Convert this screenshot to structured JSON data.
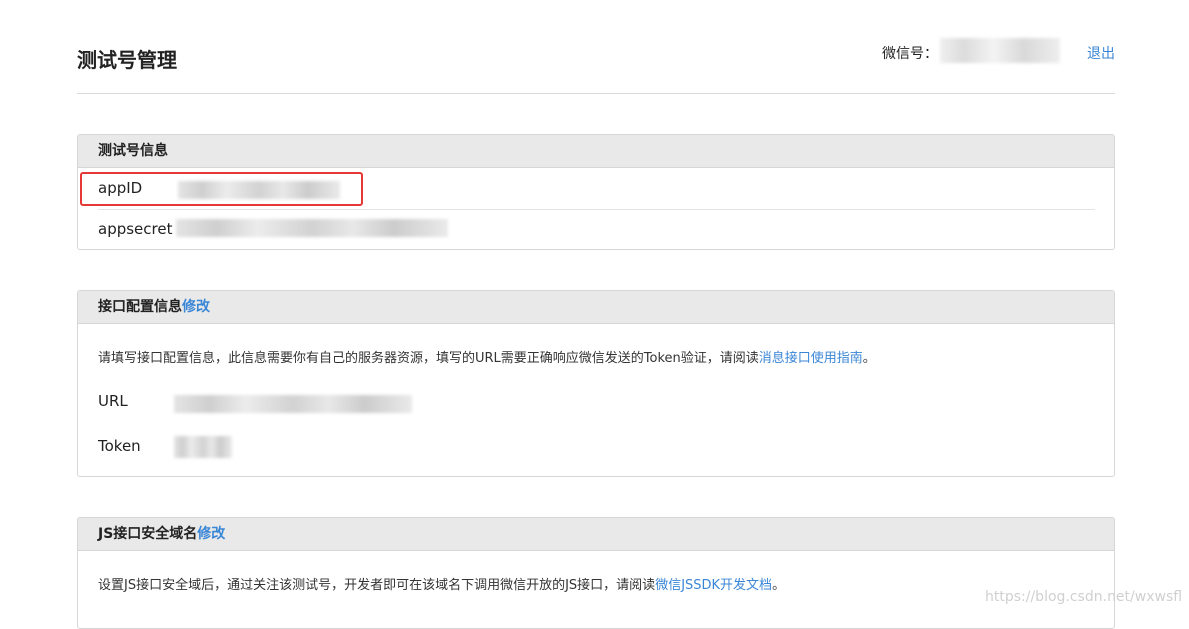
{
  "header": {
    "title": "测试号管理",
    "account_label": "微信号：",
    "logout_label": "退出"
  },
  "test_account_panel": {
    "title": "测试号信息",
    "fields": [
      {
        "label": "appID"
      },
      {
        "label": "appsecret"
      }
    ]
  },
  "interface_panel": {
    "title": "接口配置信息",
    "edit_label": "修改",
    "description": "请填写接口配置信息，此信息需要你有自己的服务器资源，填写的URL需要正确响应微信发送的Token验证，请阅读",
    "guide_link": "消息接口使用指南",
    "description_end": "。",
    "fields": [
      {
        "label": "URL"
      },
      {
        "label": "Token"
      }
    ]
  },
  "js_domain_panel": {
    "title": "JS接口安全域名",
    "edit_label": "修改",
    "description": "设置JS接口安全域后，通过关注该测试号，开发者即可在该域名下调用微信开放的JS接口，请阅读",
    "doc_link": "微信JSSDK开发文档",
    "description_end": "。"
  },
  "watermark": "https://blog.csdn.net/wxwsfl",
  "colors": {
    "link": "#3a86d6",
    "highlight": "#e53935",
    "panel_header": "#e9e9e9"
  }
}
